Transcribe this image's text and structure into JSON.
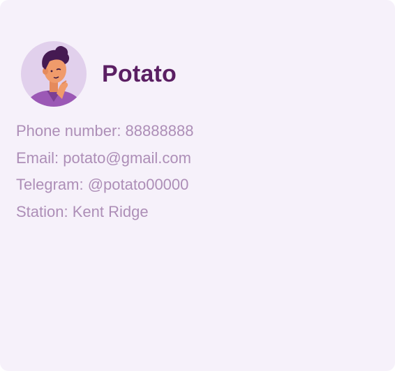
{
  "profile": {
    "name": "Potato",
    "avatar_icon": "person-thinking-avatar",
    "details": {
      "phone": "Phone number: 88888888",
      "email": "Email: potato@gmail.com",
      "telegram": "Telegram: @potato00000",
      "station": "Station: Kent Ridge"
    }
  },
  "colors": {
    "card_background": "#f6f1fa",
    "name_text": "#5b1f63",
    "detail_text": "#ad8eb7",
    "avatar_circle": "#e1d0ec",
    "avatar_shirt": "#9b58b5",
    "avatar_hair": "#451a52",
    "avatar_skin": "#f09b6b"
  }
}
